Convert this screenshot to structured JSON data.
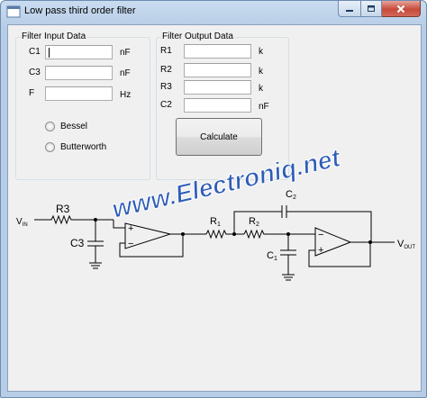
{
  "window": {
    "title": "Low pass third order filter"
  },
  "input_group": {
    "title": "Filter Input Data",
    "fields": [
      {
        "label": "C1",
        "value": "",
        "unit": "nF"
      },
      {
        "label": "C3",
        "value": "",
        "unit": "nF"
      },
      {
        "label": "F",
        "value": "",
        "unit": "Hz"
      }
    ],
    "radios": [
      {
        "label": "Bessel",
        "checked": false
      },
      {
        "label": "Butterworth",
        "checked": false
      }
    ]
  },
  "output_group": {
    "title": "Filter Output Data",
    "fields": [
      {
        "label": "R1",
        "value": "",
        "unit": "k"
      },
      {
        "label": "R2",
        "value": "",
        "unit": "k"
      },
      {
        "label": "R3",
        "value": "",
        "unit": "k"
      },
      {
        "label": "C2",
        "value": "",
        "unit": "nF"
      }
    ],
    "calculate_label": "Calculate"
  },
  "schematic": {
    "watermark": "www.Electroniq.net",
    "vin": "V",
    "vin_sub": "IN",
    "vout": "V",
    "vout_sub": "OUT",
    "r3": "R3",
    "c3": "C3",
    "r1": "R",
    "r1_sub": "1",
    "r2": "R",
    "r2_sub": "2",
    "c1": "C",
    "c1_sub": "1",
    "c2": "C",
    "c2_sub": "2",
    "plus": "+",
    "minus": "−"
  },
  "colors": {
    "watermark_fill": "#2e5db8",
    "close_button": "#c74a3a"
  }
}
